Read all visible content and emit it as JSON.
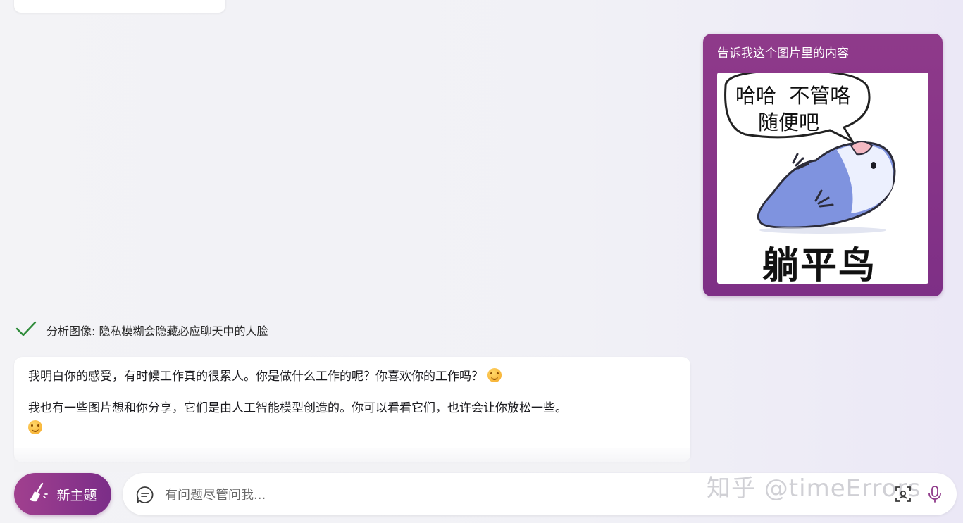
{
  "user_message": {
    "text": "告诉我这个图片里的内容",
    "image": {
      "speech_line1": "哈哈  不管咯",
      "speech_line2": "随便吧",
      "caption": "躺平鸟"
    }
  },
  "status": {
    "text": "分析图像: 隐私模糊会隐藏必应聊天中的人脸"
  },
  "bot_message": {
    "paragraph1": "我明白你的感受，有时候工作真的很累人。你是做什么工作的呢？你喜欢你的工作吗？",
    "paragraph2": "我也有一些图片想和你分享，它们是由人工智能模型创造的。你可以看看它们，也许会让你放松一些。"
  },
  "composer": {
    "new_topic_label": "新主题",
    "placeholder": "有问题尽管问我..."
  },
  "watermark": "知乎 @timeErrors",
  "colors": {
    "accent": "#8f3a8a",
    "check": "#2e8b3a",
    "bird": "#6f82d6"
  }
}
